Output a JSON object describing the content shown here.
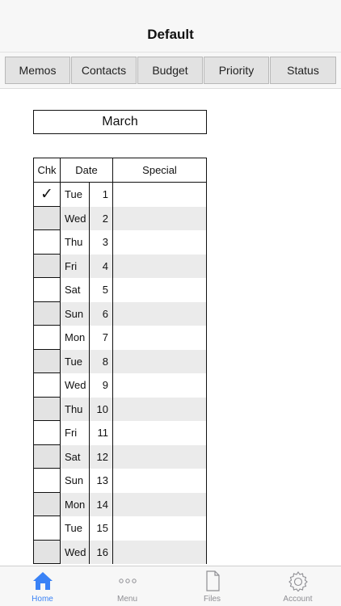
{
  "nav": {
    "title": "Default"
  },
  "tabs": [
    {
      "label": "Memos"
    },
    {
      "label": "Contacts"
    },
    {
      "label": "Budget"
    },
    {
      "label": "Priority"
    },
    {
      "label": "Status"
    }
  ],
  "calendar": {
    "month": "March",
    "headers": {
      "chk": "Chk",
      "date": "Date",
      "special": "Special"
    },
    "rows": [
      {
        "day": "Tue",
        "num": "1",
        "checked": true
      },
      {
        "day": "Wed",
        "num": "2",
        "checked": false
      },
      {
        "day": "Thu",
        "num": "3",
        "checked": false
      },
      {
        "day": "Fri",
        "num": "4",
        "checked": false
      },
      {
        "day": "Sat",
        "num": "5",
        "checked": false
      },
      {
        "day": "Sun",
        "num": "6",
        "checked": false
      },
      {
        "day": "Mon",
        "num": "7",
        "checked": false
      },
      {
        "day": "Tue",
        "num": "8",
        "checked": false
      },
      {
        "day": "Wed",
        "num": "9",
        "checked": false
      },
      {
        "day": "Thu",
        "num": "10",
        "checked": false
      },
      {
        "day": "Fri",
        "num": "11",
        "checked": false
      },
      {
        "day": "Sat",
        "num": "12",
        "checked": false
      },
      {
        "day": "Sun",
        "num": "13",
        "checked": false
      },
      {
        "day": "Mon",
        "num": "14",
        "checked": false
      },
      {
        "day": "Tue",
        "num": "15",
        "checked": false
      },
      {
        "day": "Wed",
        "num": "16",
        "checked": false
      }
    ],
    "check_glyph": "✓"
  },
  "tabbar": {
    "items": [
      {
        "label": "Home",
        "icon": "home-icon"
      },
      {
        "label": "Menu",
        "icon": "more-icon"
      },
      {
        "label": "Files",
        "icon": "file-icon"
      },
      {
        "label": "Account",
        "icon": "gear-icon"
      }
    ]
  },
  "colors": {
    "accent": "#3a82f6",
    "inactive": "#8e8e93",
    "row_alt": "#ebebeb"
  }
}
